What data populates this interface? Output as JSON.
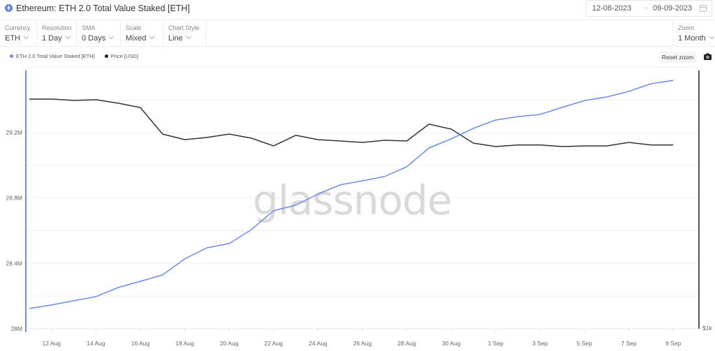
{
  "header": {
    "title_icon": "ethereum-icon",
    "title": "Ethereum: ETH 2.0 Total Value Staked [ETH]",
    "date_start": "12-08-2023",
    "date_arrow": "→",
    "date_end": "09-09-2023",
    "calendar_icon": "calendar-icon"
  },
  "toolbar": {
    "controls": [
      {
        "label": "Currency",
        "value": "ETH"
      },
      {
        "label": "Resolution",
        "value": "1 Day"
      },
      {
        "label": "SMA",
        "value": "0 Days"
      },
      {
        "label": "Scale",
        "value": "Mixed"
      },
      {
        "label": "Chart Style",
        "value": "Line"
      }
    ],
    "zoom": {
      "label": "Zoom",
      "value": "1 Month"
    }
  },
  "actions": {
    "reset_zoom": "Reset zoom",
    "camera_icon": "camera-icon"
  },
  "colors": {
    "staked": "#6c8ce6",
    "price": "#333333",
    "grid": "#f0f0f0",
    "right_axis": "#555555"
  },
  "chart_data": {
    "type": "line",
    "title": "Ethereum: ETH 2.0 Total Value Staked [ETH]",
    "watermark": "glassnode",
    "x": [
      "11 Aug",
      "12 Aug",
      "13 Aug",
      "14 Aug",
      "15 Aug",
      "16 Aug",
      "17 Aug",
      "18 Aug",
      "19 Aug",
      "20 Aug",
      "21 Aug",
      "22 Aug",
      "23 Aug",
      "24 Aug",
      "25 Aug",
      "26 Aug",
      "27 Aug",
      "28 Aug",
      "29 Aug",
      "30 Aug",
      "31 Aug",
      "1 Sep",
      "2 Sep",
      "3 Sep",
      "4 Sep",
      "5 Sep",
      "6 Sep",
      "7 Sep",
      "8 Sep",
      "9 Sep"
    ],
    "x_tick_labels": [
      "12 Aug",
      "14 Aug",
      "16 Aug",
      "18 Aug",
      "20 Aug",
      "22 Aug",
      "24 Aug",
      "26 Aug",
      "28 Aug",
      "30 Aug",
      "1 Sep",
      "3 Sep",
      "5 Sep",
      "7 Sep",
      "9 Sep"
    ],
    "left_axis": {
      "ticks": [
        28.0,
        28.4,
        28.8,
        29.2
      ],
      "tick_labels": [
        "28M",
        "28.4M",
        "28.8M",
        "29.2M"
      ],
      "range_millions": [
        28.0,
        29.6
      ],
      "grid_step_millions": 0.2
    },
    "right_axis": {
      "tick_labels": [
        "$1k"
      ],
      "range_usd": [
        1000,
        1900
      ]
    },
    "legend": {
      "placement": "top-left"
    },
    "grid": true,
    "series": [
      {
        "name": "ETH 2.0 Total Value Staked [ETH]",
        "axis": "left",
        "unit": "ETH (millions)",
        "values": [
          28.124,
          28.145,
          28.171,
          28.196,
          28.252,
          28.29,
          28.329,
          28.427,
          28.495,
          28.521,
          28.606,
          28.722,
          28.756,
          28.824,
          28.88,
          28.905,
          28.931,
          28.991,
          29.106,
          29.161,
          29.226,
          29.277,
          29.298,
          29.311,
          29.354,
          29.396,
          29.418,
          29.452,
          29.499,
          29.52
        ]
      },
      {
        "name": "Price [USD]",
        "axis": "right",
        "unit": "USD",
        "values": [
          1850,
          1850,
          1844,
          1847,
          1831,
          1811,
          1688,
          1662,
          1672,
          1688,
          1669,
          1633,
          1682,
          1662,
          1656,
          1649,
          1659,
          1656,
          1734,
          1711,
          1646,
          1630,
          1637,
          1637,
          1630,
          1633,
          1633,
          1649,
          1637,
          1637
        ]
      }
    ]
  }
}
